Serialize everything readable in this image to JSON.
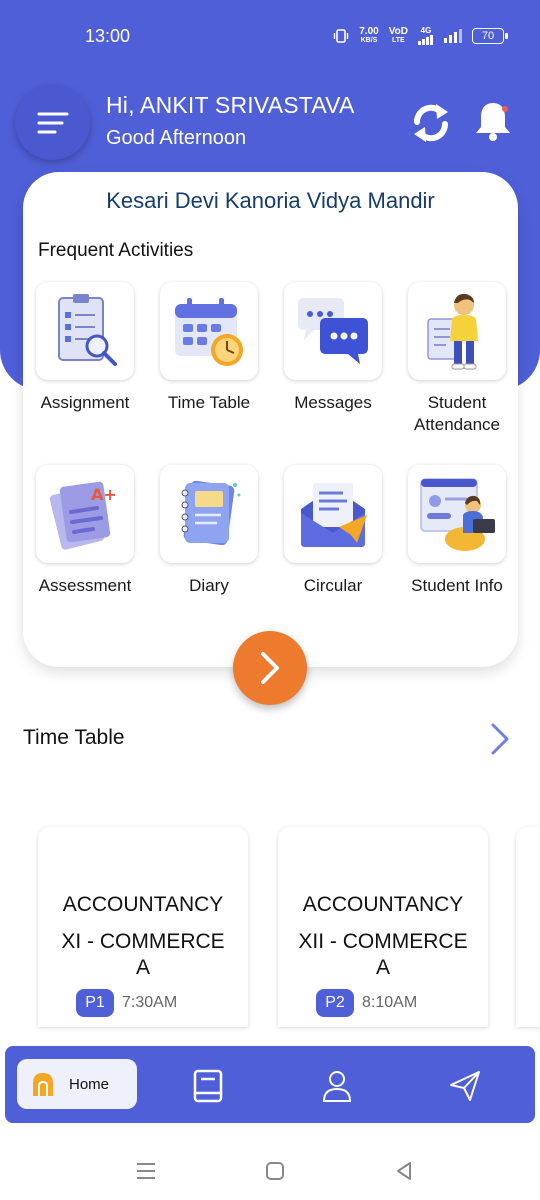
{
  "status_bar": {
    "time": "13:00",
    "speed_value": "7.00",
    "speed_unit": "KB/S",
    "volte": "VoD",
    "lte": "LTE",
    "network": "4G",
    "battery": "70"
  },
  "header": {
    "greeting_name": "Hi,  ANKIT SRIVASTAVA",
    "greeting_sub": "Good Afternoon"
  },
  "card": {
    "school_name": "Kesari Devi Kanoria Vidya Mandir",
    "section_title": "Frequent Activities",
    "activities": [
      {
        "label": "Assignment",
        "icon": "assignment-icon"
      },
      {
        "label": "Time Table",
        "icon": "calendar-icon"
      },
      {
        "label": "Messages",
        "icon": "messages-icon"
      },
      {
        "label": "Student Attendance",
        "icon": "student-attendance-icon"
      },
      {
        "label": "Assessment",
        "icon": "assessment-icon"
      },
      {
        "label": "Diary",
        "icon": "diary-icon"
      },
      {
        "label": "Circular",
        "icon": "circular-icon"
      },
      {
        "label": "Student Info",
        "icon": "student-info-icon"
      }
    ]
  },
  "timetable": {
    "title": "Time Table",
    "entries": [
      {
        "subject": "ACCOUNTANCY",
        "class": "XI - COMMERCE A",
        "period": "P1",
        "time": "7:30AM"
      },
      {
        "subject": "ACCOUNTANCY",
        "class": "XII - COMMERCE A",
        "period": "P2",
        "time": "8:10AM"
      }
    ]
  },
  "bottom_nav": {
    "home_label": "Home",
    "items": [
      "home-icon",
      "book-icon",
      "profile-icon",
      "send-icon"
    ]
  },
  "colors": {
    "primary": "#4f5fd8",
    "accent": "#ee7a2e",
    "school_name": "#173c6b"
  }
}
